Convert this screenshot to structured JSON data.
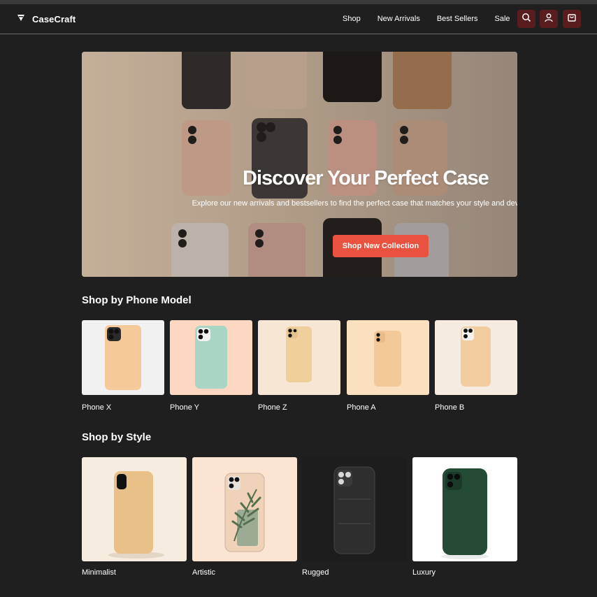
{
  "header": {
    "brand": "CaseCraft",
    "nav": [
      "Shop",
      "New Arrivals",
      "Best Sellers",
      "Sale"
    ],
    "icons": [
      "search-icon",
      "user-icon",
      "cart-icon"
    ],
    "accent_icon_bg": "#5a1d1d"
  },
  "hero": {
    "title": "Discover Your Perfect Case",
    "subtitle": "Explore our new arrivals and bestsellers to find the perfect case that matches your style and device.",
    "cta": "Shop New Collection",
    "cta_color": "#e8523f"
  },
  "phone_models": {
    "title": "Shop by Phone Model",
    "items": [
      {
        "label": "Phone X",
        "bg": "#f1f1f1",
        "case": "#f5c99a"
      },
      {
        "label": "Phone Y",
        "bg": "#fcd7c2",
        "case": "#a9d5c4"
      },
      {
        "label": "Phone Z",
        "bg": "#f6e6d3",
        "case": "#efcf9c"
      },
      {
        "label": "Phone A",
        "bg": "#fbe0c0",
        "case": "#f3c999"
      },
      {
        "label": "Phone B",
        "bg": "#f6ebe0",
        "case": "#f0cc9e"
      }
    ]
  },
  "styles": {
    "title": "Shop by Style",
    "items": [
      {
        "label": "Minimalist",
        "bg": "#f6ecdf",
        "case": "#e8c088"
      },
      {
        "label": "Artistic",
        "bg": "#fbe5d2",
        "case": "#efd2b8"
      },
      {
        "label": "Rugged",
        "bg": "#1d1d1d",
        "case": "#2e2e2e"
      },
      {
        "label": "Luxury",
        "bg": "#ffffff",
        "case": "#244b36"
      }
    ]
  }
}
